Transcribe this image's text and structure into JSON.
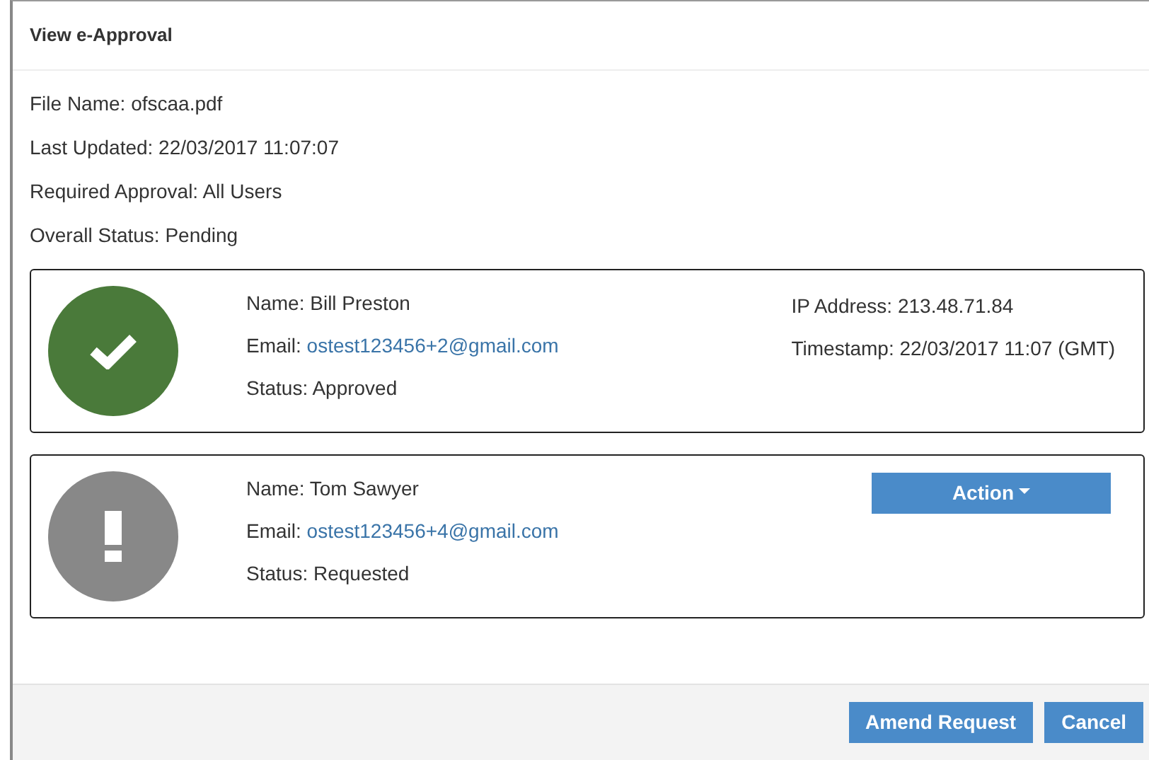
{
  "window": {
    "title": "View e-Approval"
  },
  "details": [
    "File Name: ofscaa.pdf",
    "Last Updated: 22/03/2017 11:07:07",
    "Required Approval: All Users",
    "Overall Status: Pending"
  ],
  "approvers": [
    {
      "approved": true,
      "fields": [
        {
          "kind": "text",
          "label": "Name:",
          "value": "Bill Preston"
        },
        {
          "kind": "link",
          "label": "Email:",
          "value": "ostest123456+2@gmail.com"
        },
        {
          "kind": "text",
          "label": "Status:",
          "value": "Approved"
        }
      ],
      "extra": [
        "IP Address: 213.48.71.84",
        "Timestamp: 22/03/2017 11:07 (GMT)"
      ]
    },
    {
      "approved": false,
      "fields": [
        {
          "kind": "text",
          "label": "Name:",
          "value": "Tom Sawyer"
        },
        {
          "kind": "link",
          "label": "Email:",
          "value": "ostest123456+4@gmail.com"
        },
        {
          "kind": "text",
          "label": "Status:",
          "value": "Requested"
        }
      ],
      "action": "Action"
    }
  ],
  "buttons": [
    "Amend Request",
    "Cancel"
  ]
}
